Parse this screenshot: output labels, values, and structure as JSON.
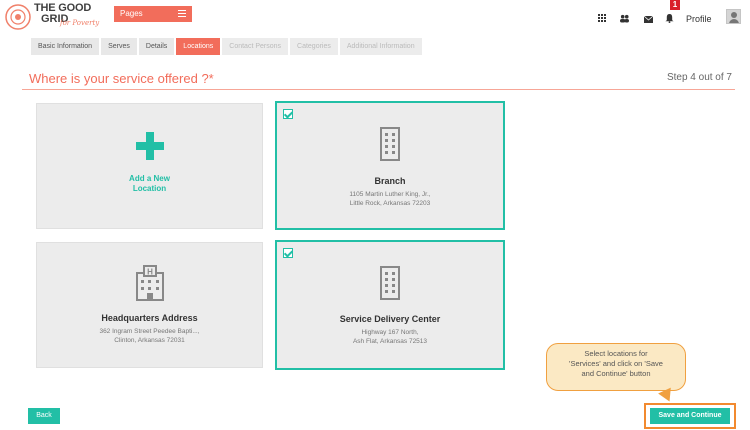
{
  "brand": {
    "line1": "THE GOOD",
    "line2": "GRID",
    "tagline": "for Poverty"
  },
  "header": {
    "pages_label": "Pages",
    "notification_count": "1",
    "profile_label": "Profile"
  },
  "tabs": [
    {
      "label": "Basic Information"
    },
    {
      "label": "Serves"
    },
    {
      "label": "Details"
    },
    {
      "label": "Locations"
    },
    {
      "label": "Contact Persons"
    },
    {
      "label": "Categories"
    },
    {
      "label": "Additional Information"
    }
  ],
  "heading": "Where is your service offered ?*",
  "step": "Step 4 out of 7",
  "cards": {
    "add": {
      "label_line1": "Add a New",
      "label_line2": "Location"
    },
    "branch": {
      "title": "Branch",
      "addr1": "1105 Martin Luther King, Jr.,",
      "addr2": "Little Rock, Arkansas 72203"
    },
    "hq": {
      "title": "Headquarters Address",
      "addr1": "362 Ingram Street Peedee Bapti...,",
      "addr2": "Clinton, Arkansas 72031"
    },
    "sdc": {
      "title": "Service Delivery Center",
      "addr1": "Highway 167 North,",
      "addr2": "Ash Flat, Arkansas 72513"
    }
  },
  "tooltip": {
    "line1": "Select locations for",
    "line2": "'Services' and click on 'Save",
    "line3": "and Continue' button"
  },
  "buttons": {
    "back": "Back",
    "save": "Save and Continue"
  },
  "colors": {
    "accent": "#f26d5b",
    "teal": "#22bfa6",
    "highlight": "#f28a2f"
  }
}
